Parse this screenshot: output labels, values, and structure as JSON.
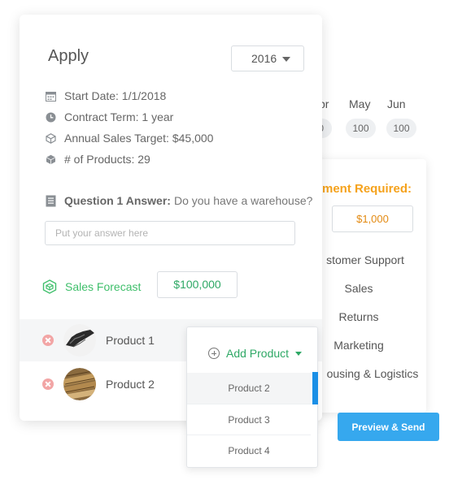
{
  "months": {
    "headers": [
      "pr",
      "May",
      "Jun"
    ],
    "values": [
      "0",
      "100",
      "100"
    ]
  },
  "payment": {
    "required_label": "ment Required:",
    "amount": "$1,000",
    "departments": [
      "stomer Support",
      "Sales",
      "Returns",
      "Marketing",
      "ousing & Logistics"
    ]
  },
  "preview_button": "Preview & Send",
  "card": {
    "title": "Apply",
    "year": "2016",
    "info": {
      "start_date": "Start Date: 1/1/2018",
      "contract_term": "Contract Term: 1 year",
      "sales_target": "Annual Sales Target: $45,000",
      "products_count": "# of Products: 29"
    },
    "question": {
      "label": "Question 1 Answer:",
      "text": "Do you have a warehouse?",
      "placeholder": "Put your answer here"
    },
    "forecast": {
      "label": "Sales Forecast",
      "value": "$100,000"
    },
    "products": [
      "Product 1",
      "Product 2"
    ]
  },
  "dropdown": {
    "add_label": "Add Product",
    "options": [
      "Product 2",
      "Product 3",
      "Product 4"
    ]
  },
  "colors": {
    "accent_green": "#2ea865",
    "accent_orange": "#f5a21c",
    "button_blue": "#36a8ee",
    "remove_red": "#f2a5a5"
  }
}
